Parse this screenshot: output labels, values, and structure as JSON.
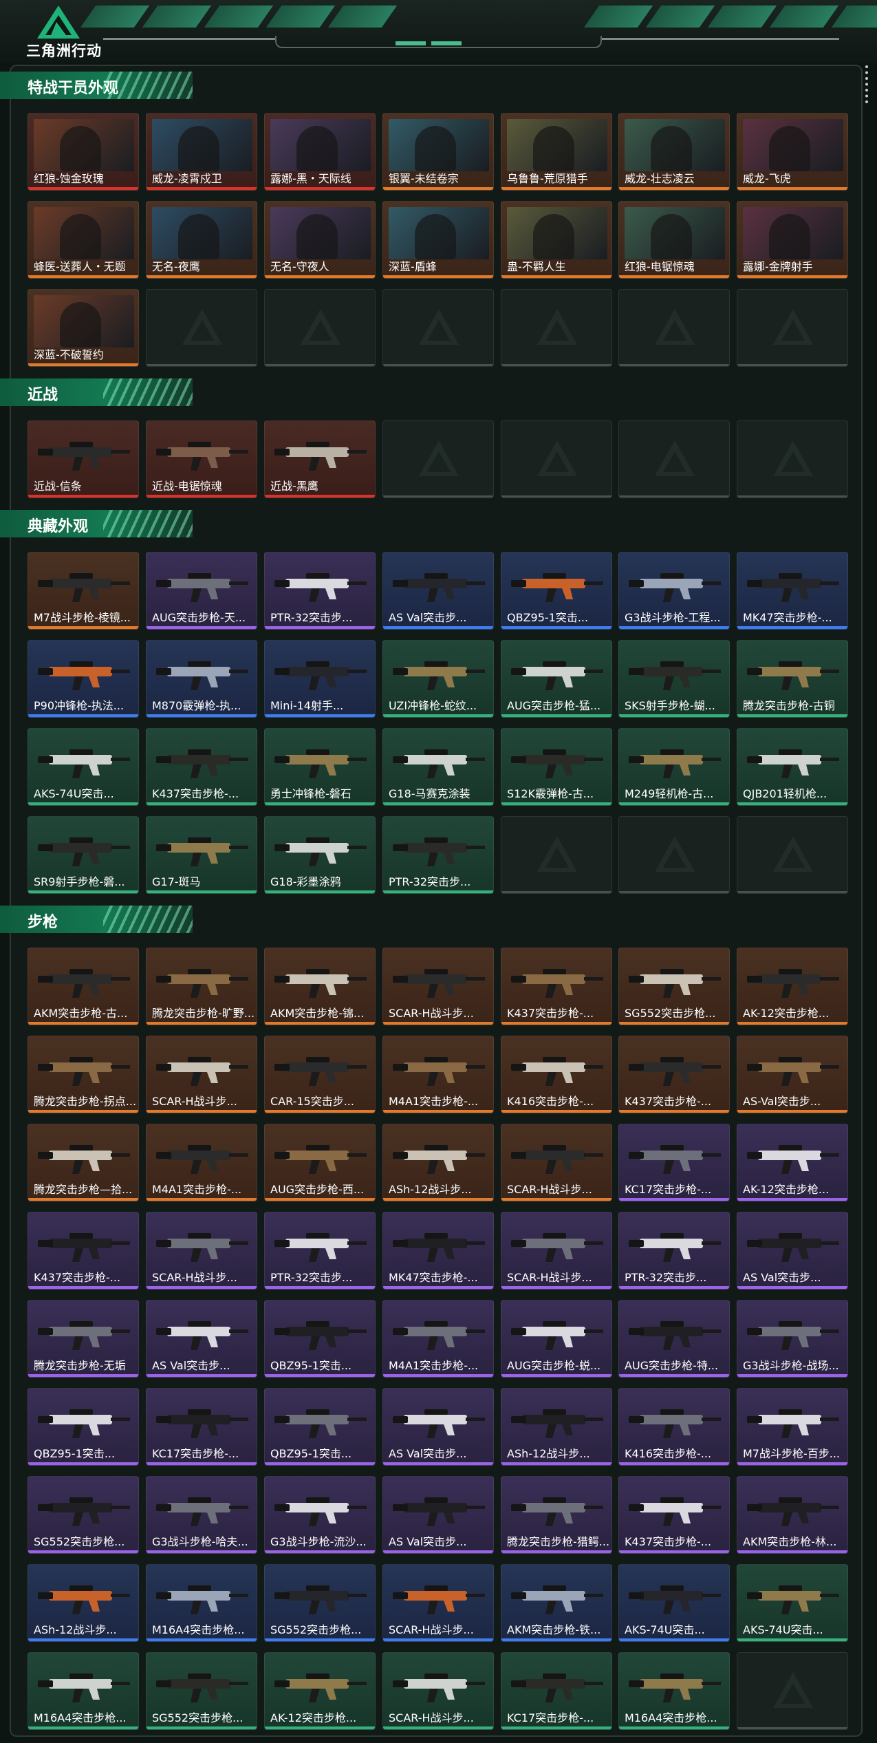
{
  "header": {
    "game_title": "三角洲行动"
  },
  "sections": [
    {
      "title": "特战干员外观",
      "items": [
        {
          "name": "红狼-蚀金玫瑰",
          "rarity": "red"
        },
        {
          "name": "威龙-凌霄戍卫",
          "rarity": "red"
        },
        {
          "name": "露娜-黑・天际线",
          "rarity": "red"
        },
        {
          "name": "银翼-未结卷宗",
          "rarity": "orange"
        },
        {
          "name": "乌鲁鲁-荒原猎手",
          "rarity": "orange"
        },
        {
          "name": "威龙-壮志凌云",
          "rarity": "orange"
        },
        {
          "name": "威龙-飞虎",
          "rarity": "orange"
        },
        {
          "name": "蜂医-送葬人・无题",
          "rarity": "orange"
        },
        {
          "name": "无名-夜鹰",
          "rarity": "orange"
        },
        {
          "name": "无名-守夜人",
          "rarity": "orange"
        },
        {
          "name": "深蓝-盾蜂",
          "rarity": "orange"
        },
        {
          "name": "蛊-不羁人生",
          "rarity": "orange"
        },
        {
          "name": "红狼-电锯惊魂",
          "rarity": "orange"
        },
        {
          "name": "露娜-金牌射手",
          "rarity": "orange"
        },
        {
          "name": "深蓝-不破誓约",
          "rarity": "orange"
        },
        {
          "name": "",
          "rarity": "empty"
        },
        {
          "name": "",
          "rarity": "empty"
        },
        {
          "name": "",
          "rarity": "empty"
        },
        {
          "name": "",
          "rarity": "empty"
        },
        {
          "name": "",
          "rarity": "empty"
        },
        {
          "name": "",
          "rarity": "empty"
        }
      ]
    },
    {
      "title": "近战",
      "items": [
        {
          "name": "近战-信条",
          "rarity": "red"
        },
        {
          "name": "近战-电锯惊魂",
          "rarity": "red"
        },
        {
          "name": "近战-黑鹰",
          "rarity": "red"
        },
        {
          "name": "",
          "rarity": "empty"
        },
        {
          "name": "",
          "rarity": "empty"
        },
        {
          "name": "",
          "rarity": "empty"
        },
        {
          "name": "",
          "rarity": "empty"
        }
      ]
    },
    {
      "title": "典藏外观",
      "items": [
        {
          "name": "M7战斗步枪-棱镜...",
          "rarity": "orange"
        },
        {
          "name": "AUG突击步枪-天...",
          "rarity": "purple"
        },
        {
          "name": "PTR-32突击步...",
          "rarity": "purple"
        },
        {
          "name": "AS Val突击步...",
          "rarity": "blue"
        },
        {
          "name": "QBZ95-1突击...",
          "rarity": "blue"
        },
        {
          "name": "G3战斗步枪-工程...",
          "rarity": "blue"
        },
        {
          "name": "MK47突击步枪-...",
          "rarity": "blue"
        },
        {
          "name": "P90冲锋枪-执法...",
          "rarity": "blue"
        },
        {
          "name": "M870霰弹枪-执...",
          "rarity": "blue"
        },
        {
          "name": "Mini-14射手...",
          "rarity": "blue"
        },
        {
          "name": "UZI冲锋枪-蛇纹...",
          "rarity": "green"
        },
        {
          "name": "AUG突击步枪-猛...",
          "rarity": "green"
        },
        {
          "name": "SKS射手步枪-蝴...",
          "rarity": "green"
        },
        {
          "name": "腾龙突击步枪-古铜",
          "rarity": "green"
        },
        {
          "name": "AKS-74U突击...",
          "rarity": "green"
        },
        {
          "name": "K437突击步枪-...",
          "rarity": "green"
        },
        {
          "name": "勇士冲锋枪-磐石",
          "rarity": "green"
        },
        {
          "name": "G18-马赛克涂装",
          "rarity": "green"
        },
        {
          "name": "S12K霰弹枪-古...",
          "rarity": "green"
        },
        {
          "name": "M249轻机枪-古...",
          "rarity": "green"
        },
        {
          "name": "QJB201轻机枪...",
          "rarity": "green"
        },
        {
          "name": "SR9射手步枪-磐...",
          "rarity": "green"
        },
        {
          "name": "G17-斑马",
          "rarity": "green"
        },
        {
          "name": "G18-彩墨涂鸦",
          "rarity": "green"
        },
        {
          "name": "PTR-32突击步...",
          "rarity": "green"
        },
        {
          "name": "",
          "rarity": "empty"
        },
        {
          "name": "",
          "rarity": "empty"
        },
        {
          "name": "",
          "rarity": "empty"
        }
      ]
    },
    {
      "title": "步枪",
      "items": [
        {
          "name": "AKM突击步枪-古...",
          "rarity": "orange"
        },
        {
          "name": "腾龙突击步枪-旷野...",
          "rarity": "orange"
        },
        {
          "name": "AKM突击步枪-锦...",
          "rarity": "orange"
        },
        {
          "name": "SCAR-H战斗步...",
          "rarity": "orange"
        },
        {
          "name": "K437突击步枪-...",
          "rarity": "orange"
        },
        {
          "name": "SG552突击步枪...",
          "rarity": "orange"
        },
        {
          "name": "AK-12突击步枪...",
          "rarity": "orange"
        },
        {
          "name": "腾龙突击步枪-拐点...",
          "rarity": "orange"
        },
        {
          "name": "SCAR-H战斗步...",
          "rarity": "orange"
        },
        {
          "name": "CAR-15突击步...",
          "rarity": "orange"
        },
        {
          "name": "M4A1突击步枪-...",
          "rarity": "orange"
        },
        {
          "name": "K416突击步枪-...",
          "rarity": "orange"
        },
        {
          "name": "K437突击步枪-...",
          "rarity": "orange"
        },
        {
          "name": "AS-Val突击步...",
          "rarity": "orange"
        },
        {
          "name": "腾龙突击步枪—拾...",
          "rarity": "orange"
        },
        {
          "name": "M4A1突击步枪-...",
          "rarity": "orange"
        },
        {
          "name": "AUG突击步枪-西...",
          "rarity": "orange"
        },
        {
          "name": "ASh-12战斗步...",
          "rarity": "orange"
        },
        {
          "name": "SCAR-H战斗步...",
          "rarity": "orange"
        },
        {
          "name": "KC17突击步枪-...",
          "rarity": "purple"
        },
        {
          "name": "AK-12突击步枪...",
          "rarity": "purple"
        },
        {
          "name": "K437突击步枪-...",
          "rarity": "purple"
        },
        {
          "name": "SCAR-H战斗步...",
          "rarity": "purple"
        },
        {
          "name": "PTR-32突击步...",
          "rarity": "purple"
        },
        {
          "name": "MK47突击步枪-...",
          "rarity": "purple"
        },
        {
          "name": "SCAR-H战斗步...",
          "rarity": "purple"
        },
        {
          "name": "PTR-32突击步...",
          "rarity": "purple"
        },
        {
          "name": "AS Val突击步...",
          "rarity": "purple"
        },
        {
          "name": "腾龙突击步枪-无垢",
          "rarity": "purple"
        },
        {
          "name": "AS Val突击步...",
          "rarity": "purple"
        },
        {
          "name": "QBZ95-1突击...",
          "rarity": "purple"
        },
        {
          "name": "M4A1突击步枪-...",
          "rarity": "purple"
        },
        {
          "name": "AUG突击步枪-蜕...",
          "rarity": "purple"
        },
        {
          "name": "AUG突击步枪-特...",
          "rarity": "purple"
        },
        {
          "name": "G3战斗步枪-战场...",
          "rarity": "purple"
        },
        {
          "name": "QBZ95-1突击...",
          "rarity": "purple"
        },
        {
          "name": "KC17突击步枪-...",
          "rarity": "purple"
        },
        {
          "name": "QBZ95-1突击...",
          "rarity": "purple"
        },
        {
          "name": "AS Val突击步...",
          "rarity": "purple"
        },
        {
          "name": "ASh-12战斗步...",
          "rarity": "purple"
        },
        {
          "name": "K416突击步枪-...",
          "rarity": "purple"
        },
        {
          "name": "M7战斗步枪-百步...",
          "rarity": "purple"
        },
        {
          "name": "SG552突击步枪...",
          "rarity": "purple"
        },
        {
          "name": "G3战斗步枪-哈夫...",
          "rarity": "purple"
        },
        {
          "name": "G3战斗步枪-流沙...",
          "rarity": "purple"
        },
        {
          "name": "AS Val突击步...",
          "rarity": "purple"
        },
        {
          "name": "腾龙突击步枪-猎鳄...",
          "rarity": "purple"
        },
        {
          "name": "K437突击步枪-...",
          "rarity": "purple"
        },
        {
          "name": "AKM突击步枪-林...",
          "rarity": "purple"
        },
        {
          "name": "ASh-12战斗步...",
          "rarity": "blue"
        },
        {
          "name": "M16A4突击步枪...",
          "rarity": "blue"
        },
        {
          "name": "SG552突击步枪...",
          "rarity": "blue"
        },
        {
          "name": "SCAR-H战斗步...",
          "rarity": "blue"
        },
        {
          "name": "AKM突击步枪-铁...",
          "rarity": "blue"
        },
        {
          "name": "AKS-74U突击...",
          "rarity": "blue"
        },
        {
          "name": "AKS-74U突击...",
          "rarity": "green"
        },
        {
          "name": "M16A4突击步枪...",
          "rarity": "green"
        },
        {
          "name": "SG552突击步枪...",
          "rarity": "green"
        },
        {
          "name": "AK-12突击步枪...",
          "rarity": "green"
        },
        {
          "name": "SCAR-H战斗步...",
          "rarity": "green"
        },
        {
          "name": "KC17突击步枪-...",
          "rarity": "green"
        },
        {
          "name": "M16A4突击步枪...",
          "rarity": "green"
        },
        {
          "name": "",
          "rarity": "empty"
        }
      ]
    }
  ]
}
